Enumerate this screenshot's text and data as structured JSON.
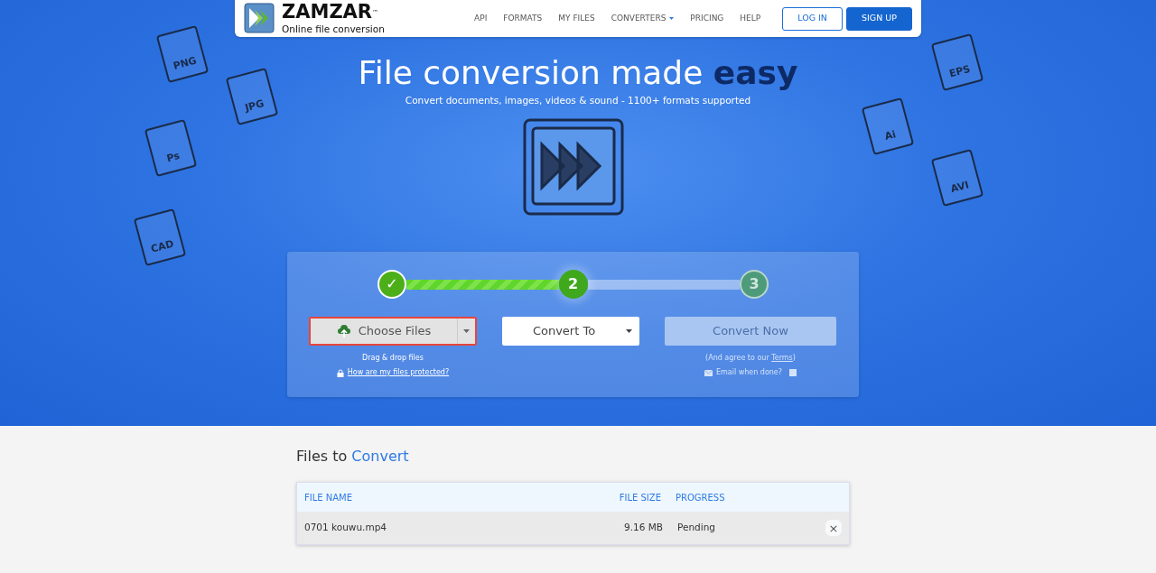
{
  "brand": {
    "name": "ZAMZAR",
    "trademark": "™",
    "tagline": "Online file conversion"
  },
  "nav": {
    "links": [
      {
        "label": "API",
        "dropdown": false
      },
      {
        "label": "FORMATS",
        "dropdown": false
      },
      {
        "label": "MY FILES",
        "dropdown": false
      },
      {
        "label": "CONVERTERS",
        "dropdown": true
      },
      {
        "label": "PRICING",
        "dropdown": false
      },
      {
        "label": "HELP",
        "dropdown": false
      }
    ],
    "login": "LOG IN",
    "signup": "SIGN UP"
  },
  "hero": {
    "title": "File conversion made **easy**",
    "subtitle": "Convert documents, images, videos & sound - 1100+ formats supported",
    "doodles": [
      {
        "label": "PNG"
      },
      {
        "label": "JPG"
      },
      {
        "label": "Ps"
      },
      {
        "label": "CAD"
      },
      {
        "label": "EPS"
      },
      {
        "label": "Ai"
      },
      {
        "label": "AVI"
      }
    ]
  },
  "steps": [
    {
      "label": "✓",
      "completed": true,
      "current": false
    },
    {
      "label": "2",
      "completed": false,
      "current": true
    },
    {
      "label": "3",
      "completed": false,
      "current": false
    }
  ],
  "choose": {
    "label": "Choose Files",
    "highlighted": true,
    "hint": "Drag & drop files",
    "protect_link": "How are my files protected?"
  },
  "convert_to": {
    "label": "Convert To"
  },
  "convert_now": {
    "label": "Convert Now",
    "disabled": true,
    "agree_before": "(And agree to our ",
    "terms": "Terms",
    "agree_after": ")",
    "email_label": "Email when done?",
    "email_checked": false
  },
  "files": {
    "heading": "Files to **Convert**",
    "columns": [
      "FILE NAME",
      "FILE SIZE",
      "PROGRESS"
    ],
    "rows": [
      {
        "name": "0701 kouwu.mp4",
        "size": "9.16 MB",
        "progress": "Pending",
        "remove": "×"
      }
    ]
  }
}
